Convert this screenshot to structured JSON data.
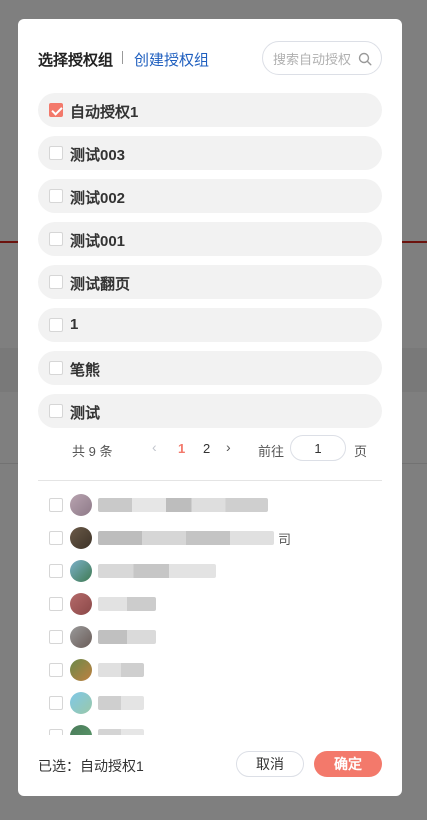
{
  "dialog": {
    "header": {
      "title": "选择授权组",
      "create_link": "创建授权组",
      "search_placeholder": "搜索自动授权",
      "search_icon": "search-icon"
    },
    "groups": [
      {
        "label": "自动授权1",
        "checked": true
      },
      {
        "label": "测试003",
        "checked": false
      },
      {
        "label": "测试002",
        "checked": false
      },
      {
        "label": "测试001",
        "checked": false
      },
      {
        "label": "测试翻页",
        "checked": false
      },
      {
        "label": "1",
        "checked": false
      },
      {
        "label": "笔熊",
        "checked": false
      },
      {
        "label": "测试",
        "checked": false
      }
    ],
    "pagination": {
      "total_text": "共 9 条",
      "current_page": "1",
      "page_2": "2",
      "goto_label": "前往",
      "goto_value": "1",
      "page_unit": "页"
    },
    "users_visible_suffix": "司",
    "footer": {
      "selected_label": "已选：自动授权1",
      "cancel_label": "取消",
      "confirm_label": "确定"
    }
  },
  "colors": {
    "accent": "#f3796b",
    "link": "#1f5fbf",
    "brand_red": "#d9261c"
  }
}
